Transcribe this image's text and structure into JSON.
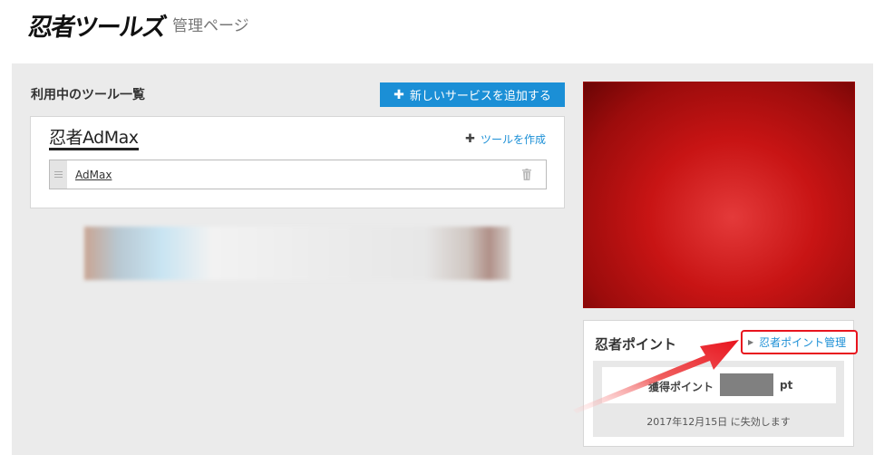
{
  "header": {
    "logo": "忍者ツールズ",
    "subtitle": "管理ページ"
  },
  "tools_section": {
    "title": "利用中のツール一覧",
    "add_service_label": "新しいサービスを追加する",
    "service": {
      "logo_text": "忍者AdMax",
      "make_tool_label": "ツールを作成",
      "tools": [
        {
          "name": "AdMax"
        }
      ]
    }
  },
  "points": {
    "title": "忍者ポイント",
    "manage_link": "忍者ポイント管理",
    "label": "獲得ポイント",
    "unit": "pt",
    "expiry": "2017年12月15日 に失効します"
  },
  "colors": {
    "accent": "#1b8fd6",
    "annotation_red": "#e8141e"
  },
  "icons": [
    "plus-icon",
    "drag-handle-icon",
    "trash-icon",
    "caret-right-icon",
    "red-arrow-annotation"
  ]
}
